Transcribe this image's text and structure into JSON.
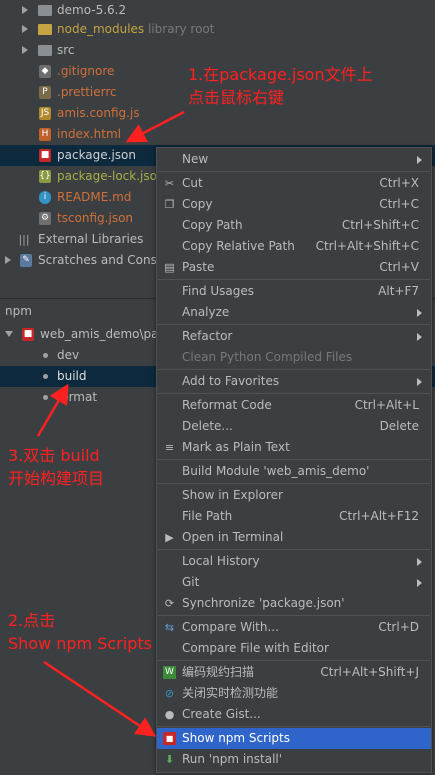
{
  "tree": {
    "items": [
      {
        "label": "demo-5.6.2",
        "suffix": ""
      },
      {
        "label": "node_modules",
        "suffix": "library root"
      },
      {
        "label": "src",
        "suffix": ""
      },
      {
        "label": ".gitignore"
      },
      {
        "label": ".prettierrc"
      },
      {
        "label": "amis.config.js"
      },
      {
        "label": "index.html"
      },
      {
        "label": "package.json"
      },
      {
        "label": "package-lock.json"
      },
      {
        "label": "README.md"
      },
      {
        "label": "tsconfig.json"
      },
      {
        "label": "External Libraries"
      },
      {
        "label": "Scratches and Consoles"
      }
    ]
  },
  "npm": {
    "title": "npm",
    "project": "web_amis_demo\\package.json",
    "scripts": [
      "dev",
      "build",
      "format"
    ]
  },
  "menu": {
    "items": [
      {
        "label": "New",
        "shortcut": "",
        "icon": ""
      },
      {
        "label": "Cut",
        "shortcut": "Ctrl+X",
        "icon": "scissors-icon"
      },
      {
        "label": "Copy",
        "shortcut": "Ctrl+C",
        "icon": "copy-icon"
      },
      {
        "label": "Copy Path",
        "shortcut": "Ctrl+Shift+C",
        "icon": ""
      },
      {
        "label": "Copy Relative Path",
        "shortcut": "Ctrl+Alt+Shift+C",
        "icon": ""
      },
      {
        "label": "Paste",
        "shortcut": "Ctrl+V",
        "icon": "paste-icon"
      },
      {
        "label": "Find Usages",
        "shortcut": "Alt+F7",
        "icon": ""
      },
      {
        "label": "Analyze",
        "shortcut": "",
        "icon": ""
      },
      {
        "label": "Refactor",
        "shortcut": "",
        "icon": ""
      },
      {
        "label": "Clean Python Compiled Files",
        "shortcut": "",
        "icon": ""
      },
      {
        "label": "Add to Favorites",
        "shortcut": "",
        "icon": ""
      },
      {
        "label": "Reformat Code",
        "shortcut": "Ctrl+Alt+L",
        "icon": ""
      },
      {
        "label": "Delete...",
        "shortcut": "Delete",
        "icon": ""
      },
      {
        "label": "Mark as Plain Text",
        "shortcut": "",
        "icon": "plain-text-icon"
      },
      {
        "label": "Build Module 'web_amis_demo'",
        "shortcut": "",
        "icon": ""
      },
      {
        "label": "Show in Explorer",
        "shortcut": "",
        "icon": ""
      },
      {
        "label": "File Path",
        "shortcut": "Ctrl+Alt+F12",
        "icon": ""
      },
      {
        "label": "Open in Terminal",
        "shortcut": "",
        "icon": "terminal-icon"
      },
      {
        "label": "Local History",
        "shortcut": "",
        "icon": ""
      },
      {
        "label": "Git",
        "shortcut": "",
        "icon": ""
      },
      {
        "label": "Synchronize 'package.json'",
        "shortcut": "",
        "icon": "sync-icon"
      },
      {
        "label": "Compare With...",
        "shortcut": "Ctrl+D",
        "icon": "compare-icon"
      },
      {
        "label": "Compare File with Editor",
        "shortcut": "",
        "icon": ""
      },
      {
        "label": "编码规约扫描",
        "shortcut": "Ctrl+Alt+Shift+J",
        "icon": "scan-icon"
      },
      {
        "label": "关闭实时检测功能",
        "shortcut": "",
        "icon": "block-icon"
      },
      {
        "label": "Create Gist...",
        "shortcut": "",
        "icon": "github-icon"
      },
      {
        "label": "Show npm Scripts",
        "shortcut": "",
        "icon": "npm-icon"
      },
      {
        "label": "Run 'npm install'",
        "shortcut": "",
        "icon": "download-icon"
      }
    ]
  },
  "annotations": {
    "a1_line1": "1.在package.json文件上",
    "a1_line2": "点击鼠标右键",
    "a2_line1": "2.点击",
    "a2_line2": "Show npm Scripts",
    "a3_line1": "3.双击 build",
    "a3_line2": "开始构建项目"
  },
  "colors": {
    "annotation": "#ff2020",
    "highlight": "#2f65ca",
    "selection": "#0d293e"
  }
}
